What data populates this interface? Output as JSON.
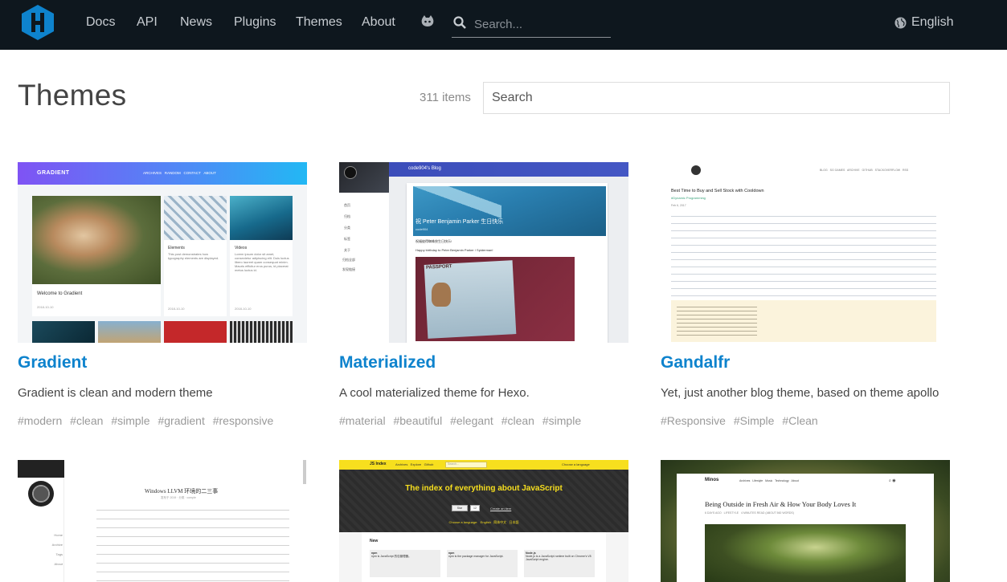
{
  "header": {
    "nav": [
      {
        "label": "Docs"
      },
      {
        "label": "API"
      },
      {
        "label": "News"
      },
      {
        "label": "Plugins"
      },
      {
        "label": "Themes"
      },
      {
        "label": "About"
      }
    ],
    "search_placeholder": "Search...",
    "language": "English"
  },
  "page": {
    "title": "Themes",
    "count": "311 items",
    "search_placeholder": "Search"
  },
  "cards": [
    {
      "name": "Gradient",
      "description": "Gradient is clean and modern theme",
      "tags": [
        "#modern",
        "#clean",
        "#simple",
        "#gradient",
        "#responsive"
      ],
      "thumb": {
        "brand": "GRADIENT",
        "menu": "ARCHIVES   RANDOM   CONTACT   ABOUT",
        "post1": "Welcome to Gradient",
        "post2": "Elements",
        "post2_body": "This post demonstrates how typography elements are displayed.",
        "post3": "Videos",
        "post3_body": "Lorem ipsum dolor sit amet, consectetur adipiscing elit. Duis luctus libero laoreet quam consequat minim. Mauris efficitur eros purus, id placerat metus luctus id.",
        "date": "2018-10-10",
        "date2": "2018-10-10",
        "date3": "2018-10-10"
      }
    },
    {
      "name": "Materialized",
      "description": "A cool materialized theme for Hexo.",
      "tags": [
        "#material",
        "#beautiful",
        "#elegant",
        "#clean",
        "#simple"
      ],
      "thumb": {
        "blog_title": "code904's Blog",
        "post_title": "祝 Peter Benjamin Parker 生日快乐",
        "author": "code904",
        "line1": "祝福彼得蜘蛛侠生日快乐!",
        "line2": "Happy birthday to Peter Benjamin Parker / Spiderman!",
        "menu": [
          "首页",
          "归档",
          "分类",
          "标签",
          "关于"
        ],
        "footer": [
          "归档全部",
          "发现链接"
        ],
        "passport": "PASSPORT"
      }
    },
    {
      "name": "Gandalfr",
      "description": "Yet, just another blog theme, based on theme apollo",
      "tags": [
        "#Responsive",
        "#Simple",
        "#Clean"
      ],
      "thumb": {
        "menu": "BLOG   SG GAMES   ARCHIVE   GITHUB   STACKOVERFLOW   RSS",
        "title": "Best Time to Buy and Sell Stock with Cooldown",
        "tag": "#Dynamic Programming",
        "date": "Feb 6, 2017"
      }
    },
    {
      "name": "",
      "description": "",
      "tags": [],
      "thumb": {
        "title": "Windows LLVM 环境的二三事",
        "meta": "发布于 2019 · 分类 · comple",
        "side": [
          "Home",
          "Archive",
          "Tags",
          "About"
        ]
      }
    },
    {
      "name": "",
      "description": "",
      "tags": [],
      "thumb": {
        "brand": "JS Index",
        "menu": "Archives   Explore   Github",
        "search": "Search...",
        "lang": "Choose a language",
        "headline": "The index of everything about JavaScript",
        "star": "Star",
        "stars": "12",
        "create": "Create an item",
        "choose": "Choose a language:   English   简体中文   日本語",
        "section": "New",
        "items": [
          {
            "t": "npm",
            "d": "npm is JavaScript 的包管理器。"
          },
          {
            "t": "npm",
            "d": "npm is the package manager for JavaScript."
          },
          {
            "t": "Node.js",
            "d": "Node.js is a JavaScript runtime built on Chrome's V8 JavaScript engine."
          }
        ]
      }
    },
    {
      "name": "",
      "description": "",
      "tags": [],
      "thumb": {
        "brand": "Minos",
        "menu": "Archives   Lifestyle   Music   Technology   About",
        "title": "Being Outside in Fresh Air & How Your Body Loves It",
        "meta": "6 DAYS AGO   LIFESTYLE   4 MINUTES READ (ABOUT 560 WORDS)"
      }
    }
  ],
  "colors": {
    "header_bg": "#0e171e",
    "link": "#0e83cd",
    "logo": "#0e83cd"
  }
}
